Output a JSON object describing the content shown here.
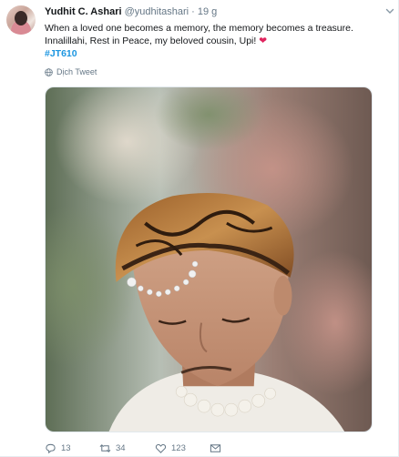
{
  "author": {
    "name": "Yudhit C. Ashari",
    "handle": "@yudhitashari",
    "separator": "·",
    "time": "19 g"
  },
  "tweet": {
    "line1": "When a loved one becomes a memory, the memory becomes a treasure.",
    "line2": "Innalillahi, Rest in Peace, my beloved cousin, Upi!",
    "heart": "❤",
    "hashtag": "#JT610"
  },
  "translate_label": "Dịch Tweet",
  "actions": {
    "replies": "13",
    "retweets": "34",
    "likes": "123"
  },
  "colors": {
    "link": "#1b95e0",
    "like": "#e0245e",
    "muted": "#657786"
  }
}
